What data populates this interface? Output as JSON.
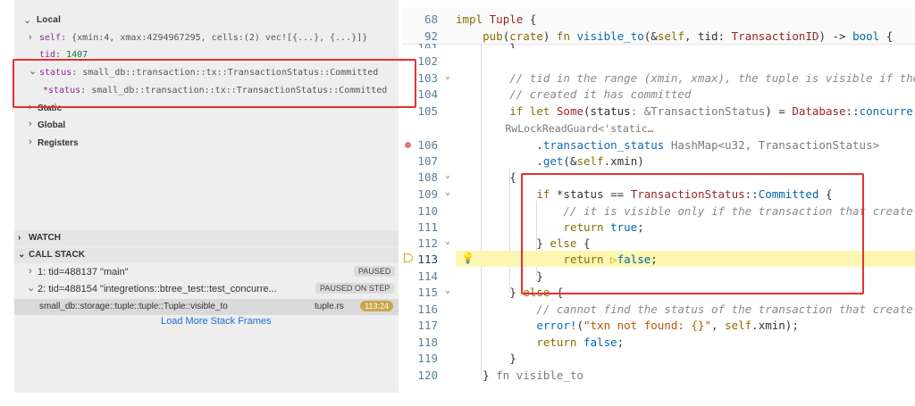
{
  "variables": {
    "local_header": "Local",
    "self_name": "self:",
    "self_value": "{xmin:4, xmax:4294967295, cells:(2) vec![{...}, {...}]}",
    "tid_name": "tid:",
    "tid_value": "1407",
    "status_name": "status:",
    "status_value": "small_db::transaction::tx::TransactionStatus::Committed",
    "deref_status_name": "*status:",
    "deref_status_value": "small_db::transaction::tx::TransactionStatus::Committed",
    "static_label": "Static",
    "global_label": "Global",
    "registers_label": "Registers"
  },
  "watch": {
    "label": "WATCH"
  },
  "call_stack": {
    "label": "CALL STACK",
    "threads": [
      {
        "label": "1: tid=488137 \"main\"",
        "state": "PAUSED"
      },
      {
        "label": "2: tid=488154 \"integretions::btree_test::test_concurre...",
        "state": "PAUSED ON STEP"
      }
    ],
    "frame": {
      "name": "small_db::storage::tuple::tuple::Tuple::visible_to",
      "file": "tuple.rs",
      "position": "113:24"
    },
    "load_more": "Load More Stack Frames"
  },
  "editor": {
    "sticky": [
      {
        "ln": "68",
        "text": "impl Tuple {"
      },
      {
        "ln": "92",
        "text": "    pub(crate) fn visible_to(&self, tid: TransactionID) -> bool {"
      }
    ],
    "lines": [
      {
        "ln": "101",
        "text": "        }"
      },
      {
        "ln": "102",
        "text": ""
      },
      {
        "ln": "103",
        "text": "        // tid in the range (xmin, xmax), the tuple is visible if the"
      },
      {
        "ln": "104",
        "text": "        // created it has committed"
      },
      {
        "ln": "105",
        "text": "        if let Some(status: &TransactionStatus) = Database::concurre"
      },
      {
        "ln": "",
        "text": "        RwLockReadGuard<'static…"
      },
      {
        "ln": "106",
        "text": "            .transaction_status HashMap<u32, TransactionStatus>"
      },
      {
        "ln": "107",
        "text": "            .get(&self.xmin)"
      },
      {
        "ln": "108",
        "text": "        {"
      },
      {
        "ln": "109",
        "text": "            if *status == TransactionStatus::Committed {"
      },
      {
        "ln": "110",
        "text": "                // it is visible only if the transaction that create"
      },
      {
        "ln": "111",
        "text": "                return true;"
      },
      {
        "ln": "112",
        "text": "            } else {"
      },
      {
        "ln": "113",
        "text": "                return false;"
      },
      {
        "ln": "114",
        "text": "            }"
      },
      {
        "ln": "115",
        "text": "        } else {"
      },
      {
        "ln": "116",
        "text": "            // cannot find the status of the transaction that create"
      },
      {
        "ln": "117",
        "text": "            error!(\"txn not found: {}\", self.xmin);"
      },
      {
        "ln": "118",
        "text": "            return false;"
      },
      {
        "ln": "119",
        "text": "        }"
      },
      {
        "ln": "120",
        "text": "    } fn visible_to"
      }
    ]
  },
  "colors": {
    "highlight_box": "#e8302f",
    "current_line": "#fbf7b1",
    "breakpoint": "#e07a7a"
  }
}
